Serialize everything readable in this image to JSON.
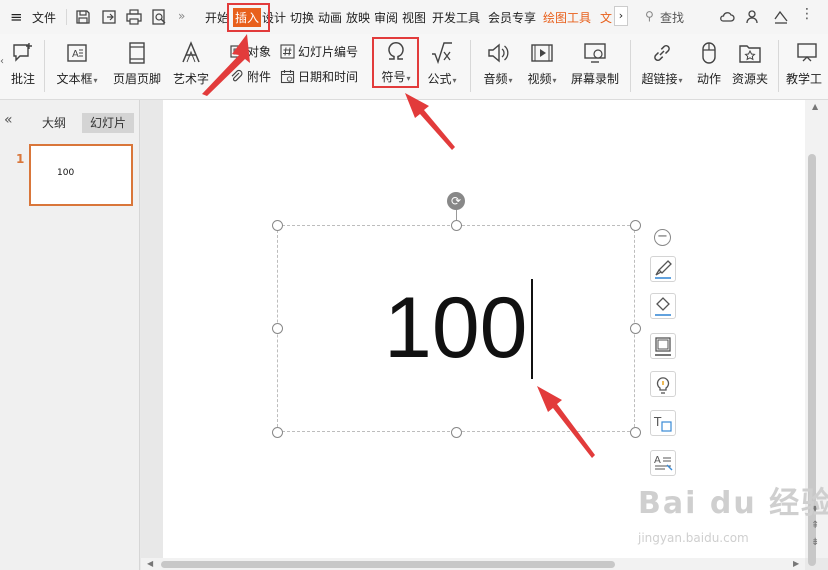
{
  "menubar": {
    "file_label": "文件",
    "tabs": [
      {
        "label": "开始"
      },
      {
        "label": "插入"
      },
      {
        "label": "设计"
      },
      {
        "label": "切换"
      },
      {
        "label": "动画"
      },
      {
        "label": "放映"
      },
      {
        "label": "审阅"
      },
      {
        "label": "视图"
      },
      {
        "label": "开发工具"
      },
      {
        "label": "会员专享"
      },
      {
        "label": "绘图工具"
      },
      {
        "label": "文"
      }
    ],
    "search_label": "查找",
    "active_tab_color": "#e8601c",
    "highlight_tab_color": "#e23b3b"
  },
  "ribbon": {
    "comment": "批注",
    "textbox": "文本框",
    "header_footer": "页眉页脚",
    "wordart": "艺术字",
    "object": "对象",
    "attachment": "附件",
    "slide_number": "幻灯片编号",
    "datetime": "日期和时间",
    "symbol": "符号",
    "formula": "公式",
    "audio": "音频",
    "video": "视频",
    "screen_record": "屏幕录制",
    "hyperlink": "超链接",
    "action": "动作",
    "resource": "资源夹",
    "teaching": "教学工"
  },
  "leftpanel": {
    "tab_outline": "大纲",
    "tab_slides": "幻灯片",
    "slide_index": "1",
    "slide_thumb_text": "100"
  },
  "slide": {
    "text": "100"
  },
  "watermark": {
    "brand": "Bai du 经验",
    "url": "jingyan.baidu.com"
  }
}
